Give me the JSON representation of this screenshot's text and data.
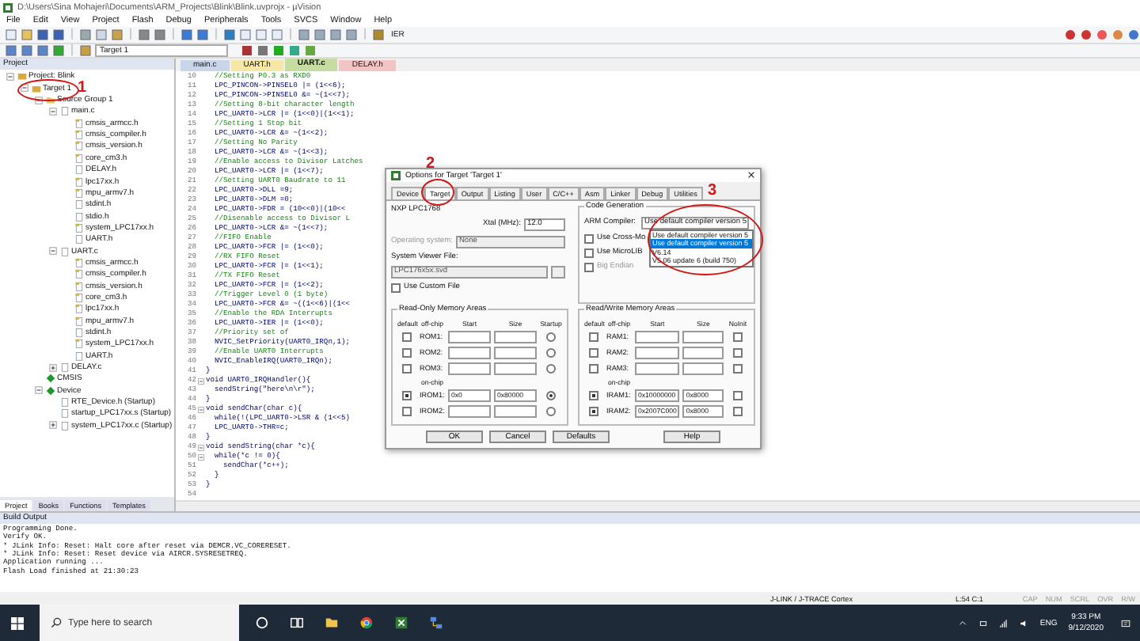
{
  "window": {
    "title": "D:\\Users\\Sina Mohajeri\\Documents\\ARM_Projects\\Blink\\Blink.uvprojx - µVision"
  },
  "menu": [
    "File",
    "Edit",
    "View",
    "Project",
    "Flash",
    "Debug",
    "Peripherals",
    "Tools",
    "SVCS",
    "Window",
    "Help"
  ],
  "toolbar": {
    "find_value": "IER",
    "target_select": "Target 1"
  },
  "project_panel": {
    "title": "Project",
    "tree": [
      {
        "label": "Project: Blink",
        "kind": "project",
        "expanded": true,
        "children": [
          {
            "label": "Target 1",
            "kind": "target",
            "expanded": true,
            "children": [
              {
                "label": "Source Group 1",
                "kind": "group",
                "expanded": true,
                "children": [
                  {
                    "label": "main.c",
                    "kind": "file",
                    "expanded": true,
                    "children": [
                      {
                        "label": "cmsis_armcc.h",
                        "kind": "header"
                      },
                      {
                        "label": "cmsis_compiler.h",
                        "kind": "header"
                      },
                      {
                        "label": "cmsis_version.h",
                        "kind": "header"
                      },
                      {
                        "label": "core_cm3.h",
                        "kind": "header"
                      },
                      {
                        "label": "DELAY.h",
                        "kind": "file"
                      },
                      {
                        "label": "lpc17xx.h",
                        "kind": "header"
                      },
                      {
                        "label": "mpu_armv7.h",
                        "kind": "header"
                      },
                      {
                        "label": "stdint.h",
                        "kind": "file"
                      },
                      {
                        "label": "stdio.h",
                        "kind": "file"
                      },
                      {
                        "label": "system_LPC17xx.h",
                        "kind": "header"
                      },
                      {
                        "label": "UART.h",
                        "kind": "file"
                      }
                    ]
                  },
                  {
                    "label": "UART.c",
                    "kind": "file",
                    "expanded": true,
                    "children": [
                      {
                        "label": "cmsis_armcc.h",
                        "kind": "header"
                      },
                      {
                        "label": "cmsis_compiler.h",
                        "kind": "header"
                      },
                      {
                        "label": "cmsis_version.h",
                        "kind": "header"
                      },
                      {
                        "label": "core_cm3.h",
                        "kind": "header"
                      },
                      {
                        "label": "lpc17xx.h",
                        "kind": "header"
                      },
                      {
                        "label": "mpu_armv7.h",
                        "kind": "header"
                      },
                      {
                        "label": "stdint.h",
                        "kind": "file"
                      },
                      {
                        "label": "system_LPC17xx.h",
                        "kind": "header"
                      },
                      {
                        "label": "UART.h",
                        "kind": "file"
                      }
                    ]
                  },
                  {
                    "label": "DELAY.c",
                    "kind": "file",
                    "expanded": false
                  }
                ]
              },
              {
                "label": "CMSIS",
                "kind": "component"
              },
              {
                "label": "Device",
                "kind": "component",
                "expanded": true,
                "children": [
                  {
                    "label": "RTE_Device.h (Startup)",
                    "kind": "file"
                  },
                  {
                    "label": "startup_LPC17xx.s (Startup)",
                    "kind": "file"
                  },
                  {
                    "label": "system_LPC17xx.c (Startup)",
                    "kind": "file",
                    "expanded": false
                  }
                ]
              }
            ]
          }
        ]
      }
    ],
    "tabs": [
      {
        "label": "Project",
        "selected": true
      },
      {
        "label": "Books",
        "selected": false
      },
      {
        "label": "Functions",
        "selected": false
      },
      {
        "label": "Templates",
        "selected": false
      }
    ]
  },
  "editor": {
    "tabs": [
      {
        "label": "main.c",
        "color": "#c9d6ea",
        "selected": false
      },
      {
        "label": "UART.h",
        "color": "#f6e7a6",
        "selected": false
      },
      {
        "label": "UART.c",
        "color": "#c6dca0",
        "selected": true
      },
      {
        "label": "DELAY.h",
        "color": "#f3c4c4",
        "selected": false
      }
    ],
    "lines": [
      {
        "n": "10",
        "text": "  //Setting P0.3 as RXD0",
        "kind": "comment"
      },
      {
        "n": "11",
        "text": "  LPC_PINCON->PINSEL0 |= (1<<6);"
      },
      {
        "n": "12",
        "text": "  LPC_PINCON->PINSEL0 &= ~(1<<7);"
      },
      {
        "n": "13",
        "text": "  //Setting 8-bit character length",
        "kind": "comment"
      },
      {
        "n": "14",
        "text": "  LPC_UART0->LCR |= (1<<0)|(1<<1);"
      },
      {
        "n": "15",
        "text": "  //Setting 1 Stop bit",
        "kind": "comment"
      },
      {
        "n": "16",
        "text": "  LPC_UART0->LCR &= ~(1<<2);"
      },
      {
        "n": "17",
        "text": "  //Setting No Parity",
        "kind": "comment"
      },
      {
        "n": "18",
        "text": "  LPC_UART0->LCR &= ~(1<<3);"
      },
      {
        "n": "19",
        "text": "  //Enable access to Divisor Latches",
        "kind": "comment"
      },
      {
        "n": "20",
        "text": "  LPC_UART0->LCR |= (1<<7);"
      },
      {
        "n": "21",
        "text": "  //Setting UART0 Baudrate to 11",
        "kind": "comment"
      },
      {
        "n": "22",
        "text": "  LPC_UART0->DLL =9;"
      },
      {
        "n": "23",
        "text": "  LPC_UART0->DLM =0;"
      },
      {
        "n": "24",
        "text": "  LPC_UART0->FDR = (10<<0)|(10<<"
      },
      {
        "n": "25",
        "text": "  //Disenable access to Divisor L",
        "kind": "comment"
      },
      {
        "n": "26",
        "text": "  LPC_UART0->LCR &= ~(1<<7);"
      },
      {
        "n": "27",
        "text": "  //FIFO Enable",
        "kind": "comment"
      },
      {
        "n": "28",
        "text": "  LPC_UART0->FCR |= (1<<0);"
      },
      {
        "n": "29",
        "text": "  //RX FIFO Reset",
        "kind": "comment"
      },
      {
        "n": "30",
        "text": "  LPC_UART0->FCR |= (1<<1);"
      },
      {
        "n": "31",
        "text": "  //TX FIFO Reset",
        "kind": "comment"
      },
      {
        "n": "32",
        "text": "  LPC_UART0->FCR |= (1<<2);"
      },
      {
        "n": "33",
        "text": "  //Trigger Level 0 (1 byte)",
        "kind": "comment"
      },
      {
        "n": "34",
        "text": "  LPC_UART0->FCR &= ~((1<<6)|(1<<"
      },
      {
        "n": "35",
        "text": "  //Enable the RDA Interrupts",
        "kind": "comment"
      },
      {
        "n": "36",
        "text": "  LPC_UART0->IER |= (1<<0);"
      },
      {
        "n": "37",
        "text": "  //Priority set of",
        "kind": "comment"
      },
      {
        "n": "38",
        "text": "  NVIC_SetPriority(UART0_IRQn,1);"
      },
      {
        "n": "39",
        "text": "  //Enable UART0 Interrupts",
        "kind": "comment"
      },
      {
        "n": "40",
        "text": "  NVIC_EnableIRQ(UART0_IRQn);"
      },
      {
        "n": "41",
        "text": "}"
      },
      {
        "n": "42",
        "text": "void UART0_IRQHandler(){",
        "expanded": true
      },
      {
        "n": "43",
        "text": "  sendString(\"here\\n\\r\");"
      },
      {
        "n": "44",
        "text": "}"
      },
      {
        "n": "45",
        "text": "void sendChar(char c){",
        "expanded": true
      },
      {
        "n": "46",
        "text": "  while(!(LPC_UART0->LSR & (1<<5)"
      },
      {
        "n": "47",
        "text": "  LPC_UART0->THR=c;"
      },
      {
        "n": "48",
        "text": "}"
      },
      {
        "n": "49",
        "text": "void sendString(char *c){",
        "expanded": true
      },
      {
        "n": "50",
        "text": "  while(*c != 0){",
        "expanded": true
      },
      {
        "n": "51",
        "text": "    sendChar(*c++);"
      },
      {
        "n": "52",
        "text": "  }"
      },
      {
        "n": "53",
        "text": "}"
      },
      {
        "n": "54"
      }
    ]
  },
  "dialog": {
    "title": "Options for Target 'Target 1'",
    "tabs": [
      {
        "label": "Device",
        "selected": false
      },
      {
        "label": "Target",
        "selected": true
      },
      {
        "label": "Output",
        "selected": false
      },
      {
        "label": "Listing",
        "selected": false
      },
      {
        "label": "User",
        "selected": false
      },
      {
        "label": "C/C++",
        "selected": false
      },
      {
        "label": "Asm",
        "selected": false
      },
      {
        "label": "Linker",
        "selected": false
      },
      {
        "label": "Debug",
        "selected": false
      },
      {
        "label": "Utilities",
        "selected": false
      }
    ],
    "device": "NXP LPC1768",
    "xtal": {
      "label": "Xtal (MHz):",
      "value": "12.0"
    },
    "os": {
      "label": "Operating system:",
      "value": "None",
      "disabled": true
    },
    "svf": {
      "label": "System Viewer File:",
      "value": "LPC176x5x.svd",
      "disabled": true
    },
    "custom_file": {
      "label": "Use Custom File",
      "checked": false
    },
    "code_generation": {
      "title": "Code Generation",
      "compiler_label": "ARM Compiler:",
      "compiler_value": "Use default compiler version 5",
      "options": [
        {
          "label": "Use default compiler version 5",
          "selected": false
        },
        {
          "label": "Use default compiler version 5",
          "selected": true
        },
        {
          "label": "V6.14",
          "selected": false
        },
        {
          "label": "V5.06 update 6 (build 750)",
          "selected": false
        }
      ],
      "checks": [
        {
          "label": "Use Cross-Mo",
          "checked": false,
          "disabled": false
        },
        {
          "label": "Use MicroLIB",
          "checked": false,
          "disabled": false
        },
        {
          "label": "Big Endian",
          "checked": false,
          "disabled": true
        }
      ]
    },
    "rom": {
      "title": "Read-Only Memory Areas",
      "headers": [
        "default",
        "off-chip",
        "Start",
        "Size",
        "Startup"
      ],
      "onchip_label": "on-chip",
      "rows": [
        {
          "label": "ROM1:",
          "default": false,
          "flag": false
        },
        {
          "label": "ROM2:",
          "default": false,
          "flag": false
        },
        {
          "label": "ROM3:",
          "default": false,
          "flag": false
        },
        {
          "label": "IROM1:",
          "default": true,
          "start": "0x0",
          "size": "0x80000",
          "flag": true
        },
        {
          "label": "IROM2:",
          "default": false,
          "flag": false
        }
      ]
    },
    "ram": {
      "title": "Read/Write Memory Areas",
      "headers": [
        "default",
        "off-chip",
        "Start",
        "Size",
        "NoInit"
      ],
      "onchip_label": "on-chip",
      "rows": [
        {
          "label": "RAM1:",
          "default": false,
          "flag": false
        },
        {
          "label": "RAM2:",
          "default": false,
          "flag": false
        },
        {
          "label": "RAM3:",
          "default": false,
          "flag": false
        },
        {
          "label": "IRAM1:",
          "default": true,
          "start": "0x10000000",
          "size": "0x8000",
          "flag": false
        },
        {
          "label": "IRAM2:",
          "default": true,
          "start": "0x2007C000",
          "size": "0x8000",
          "flag": false
        }
      ]
    },
    "buttons": [
      "OK",
      "Cancel",
      "Defaults",
      "Help"
    ]
  },
  "annotations": [
    {
      "label": "1"
    },
    {
      "label": "2"
    },
    {
      "label": "3"
    }
  ],
  "build_output": {
    "title": "Build Output",
    "lines": [
      "Programming Done.",
      "Verify OK.",
      "* JLink Info: Reset: Halt core after reset via DEMCR.VC_CORERESET.",
      "* JLink Info: Reset: Reset device via AIRCR.SYSRESETREQ.",
      "Application running ...",
      "Flash Load finished at 21:30:23"
    ]
  },
  "status_bar": {
    "debugger": "J-LINK / J-TRACE Cortex",
    "position": "L:54 C:1",
    "indicators": [
      {
        "label": "CAP",
        "on": false
      },
      {
        "label": "NUM",
        "on": false
      },
      {
        "label": "SCRL",
        "on": false
      },
      {
        "label": "OVR",
        "on": false
      },
      {
        "label": "R/W",
        "on": false
      }
    ]
  },
  "taskbar": {
    "search_placeholder": "Type here to search",
    "language": "ENG",
    "time": "9:33 PM",
    "date": "9/12/2020"
  }
}
